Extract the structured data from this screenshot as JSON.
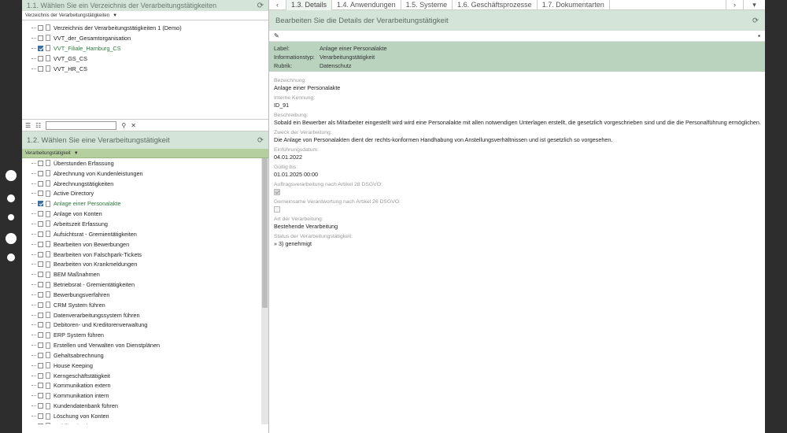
{
  "left_top": {
    "title": "1.1. Wählen Sie ein Verzeichnis der Verarbeitungstätigkeiten",
    "filter_label": "Verzeichnis der Verarbeitungstätigkeiten",
    "items": [
      {
        "label": "Verzeichnis der Verarbeitungstätigkeiten 1 (Demo)",
        "checked": false
      },
      {
        "label": "VVT_der_Gesamtorganisation",
        "checked": false
      },
      {
        "label": "VVT_Filiale_Hamburg_CS",
        "checked": true
      },
      {
        "label": "VVT_GS_CS",
        "checked": false
      },
      {
        "label": "VVT_HR_CS",
        "checked": false
      }
    ]
  },
  "search": {
    "value": "",
    "placeholder": ""
  },
  "left_bottom": {
    "title": "1.2. Wählen Sie eine Verarbeitungstätigkeit",
    "filter_label": "Verarbeitungstätigkeit",
    "items": [
      {
        "label": "Überstunden Erfassung",
        "checked": false
      },
      {
        "label": "Abrechnung von Kundenleistungen",
        "checked": false
      },
      {
        "label": "Abrechnungstätigkeiten",
        "checked": false
      },
      {
        "label": "Active Directory",
        "checked": false
      },
      {
        "label": "Anlage einer Personalakte",
        "checked": true
      },
      {
        "label": "Anlage von Konten",
        "checked": false
      },
      {
        "label": "Arbeitszeit Erfassung",
        "checked": false
      },
      {
        "label": "Aufsichtsrat - Gremientätigkeiten",
        "checked": false
      },
      {
        "label": "Bearbeiten von Bewerbungen",
        "checked": false
      },
      {
        "label": "Bearbeiten von Falschpark-Tickets",
        "checked": false
      },
      {
        "label": "Bearbeiten von Krankmeldungen",
        "checked": false
      },
      {
        "label": "BEM Maßnahmen",
        "checked": false
      },
      {
        "label": "Betriebsrat - Gremientätigkeiten",
        "checked": false
      },
      {
        "label": "Bewerbungsverfahren",
        "checked": false
      },
      {
        "label": "CRM System führen",
        "checked": false
      },
      {
        "label": "Datenverarbeitungssystem führen",
        "checked": false
      },
      {
        "label": "Debitoren- und Kreditorenverwaltung",
        "checked": false
      },
      {
        "label": "ERP System führen",
        "checked": false
      },
      {
        "label": "Erstellen und Verwalten von Dienstplänen",
        "checked": false
      },
      {
        "label": "Gehaltsabrechnung",
        "checked": false
      },
      {
        "label": "House Keeping",
        "checked": false
      },
      {
        "label": "Kerngeschäftstätigkeit",
        "checked": false
      },
      {
        "label": "Kommunikation extern",
        "checked": false
      },
      {
        "label": "Kommunikation intern",
        "checked": false
      },
      {
        "label": "Kundendatenbank führen",
        "checked": false
      },
      {
        "label": "Löschung von Konten",
        "checked": false
      },
      {
        "label": "Mobilität / Fahrzeuge",
        "checked": false
      }
    ]
  },
  "tabs": {
    "prev": "‹",
    "next": "›",
    "drop": "▾",
    "items": [
      "1.3. Details",
      "1.4. Anwendungen",
      "1.5. Systeme",
      "1.6. Geschäftsprozesse",
      "1.7. Dokumentarten"
    ]
  },
  "detail": {
    "title": "Bearbeiten Sie die Details der Verarbeitungstätigkeit",
    "info": [
      {
        "k": "Label:",
        "v": "Anlage einer Personalakte"
      },
      {
        "k": "Informationstyp:",
        "v": "Verarbeitungstätigkeit"
      },
      {
        "k": "Rubrik:",
        "v": "Datenschutz"
      }
    ],
    "fields": [
      {
        "label": "Bezeichnung:",
        "value": "Anlage einer Personalakte"
      },
      {
        "label": "Interne Kennung:",
        "value": "ID_91"
      },
      {
        "label": "Beschreibung:",
        "value": "Sobald ein Bewerber als Mitarbeiter eingestellt wird wird eine Personalakte mit allen notwendigen Unterlagen erstellt, die gesetzlich vorgeschrieben sind und die die Personalführung ermöglichen."
      },
      {
        "label": "Zweck der Verarbeitung:",
        "value": "Die Anlage von Personalakten dient der rechts-konformen Handhabung von Anstellungsverhältnissen und ist gesetzlich so vorgesehen."
      },
      {
        "label": "Einführungsdatum:",
        "value": "04.01.2022"
      },
      {
        "label": "Gültig bis:",
        "value": "01.01.2025 00:00"
      }
    ],
    "check1_label": "Auftragsverarbeitung nach Artikel 28 DSGVO:",
    "check2_label": "Gemeinsame Verantwortung nach Artikel 26 DSGVO:",
    "fields2": [
      {
        "label": "Art der Verarbeitung:",
        "value": "Bestehende Verarbeitung"
      },
      {
        "label": "Status der Verarbeitungstätigkeit:",
        "value": "» 3) genehmigt"
      }
    ]
  }
}
